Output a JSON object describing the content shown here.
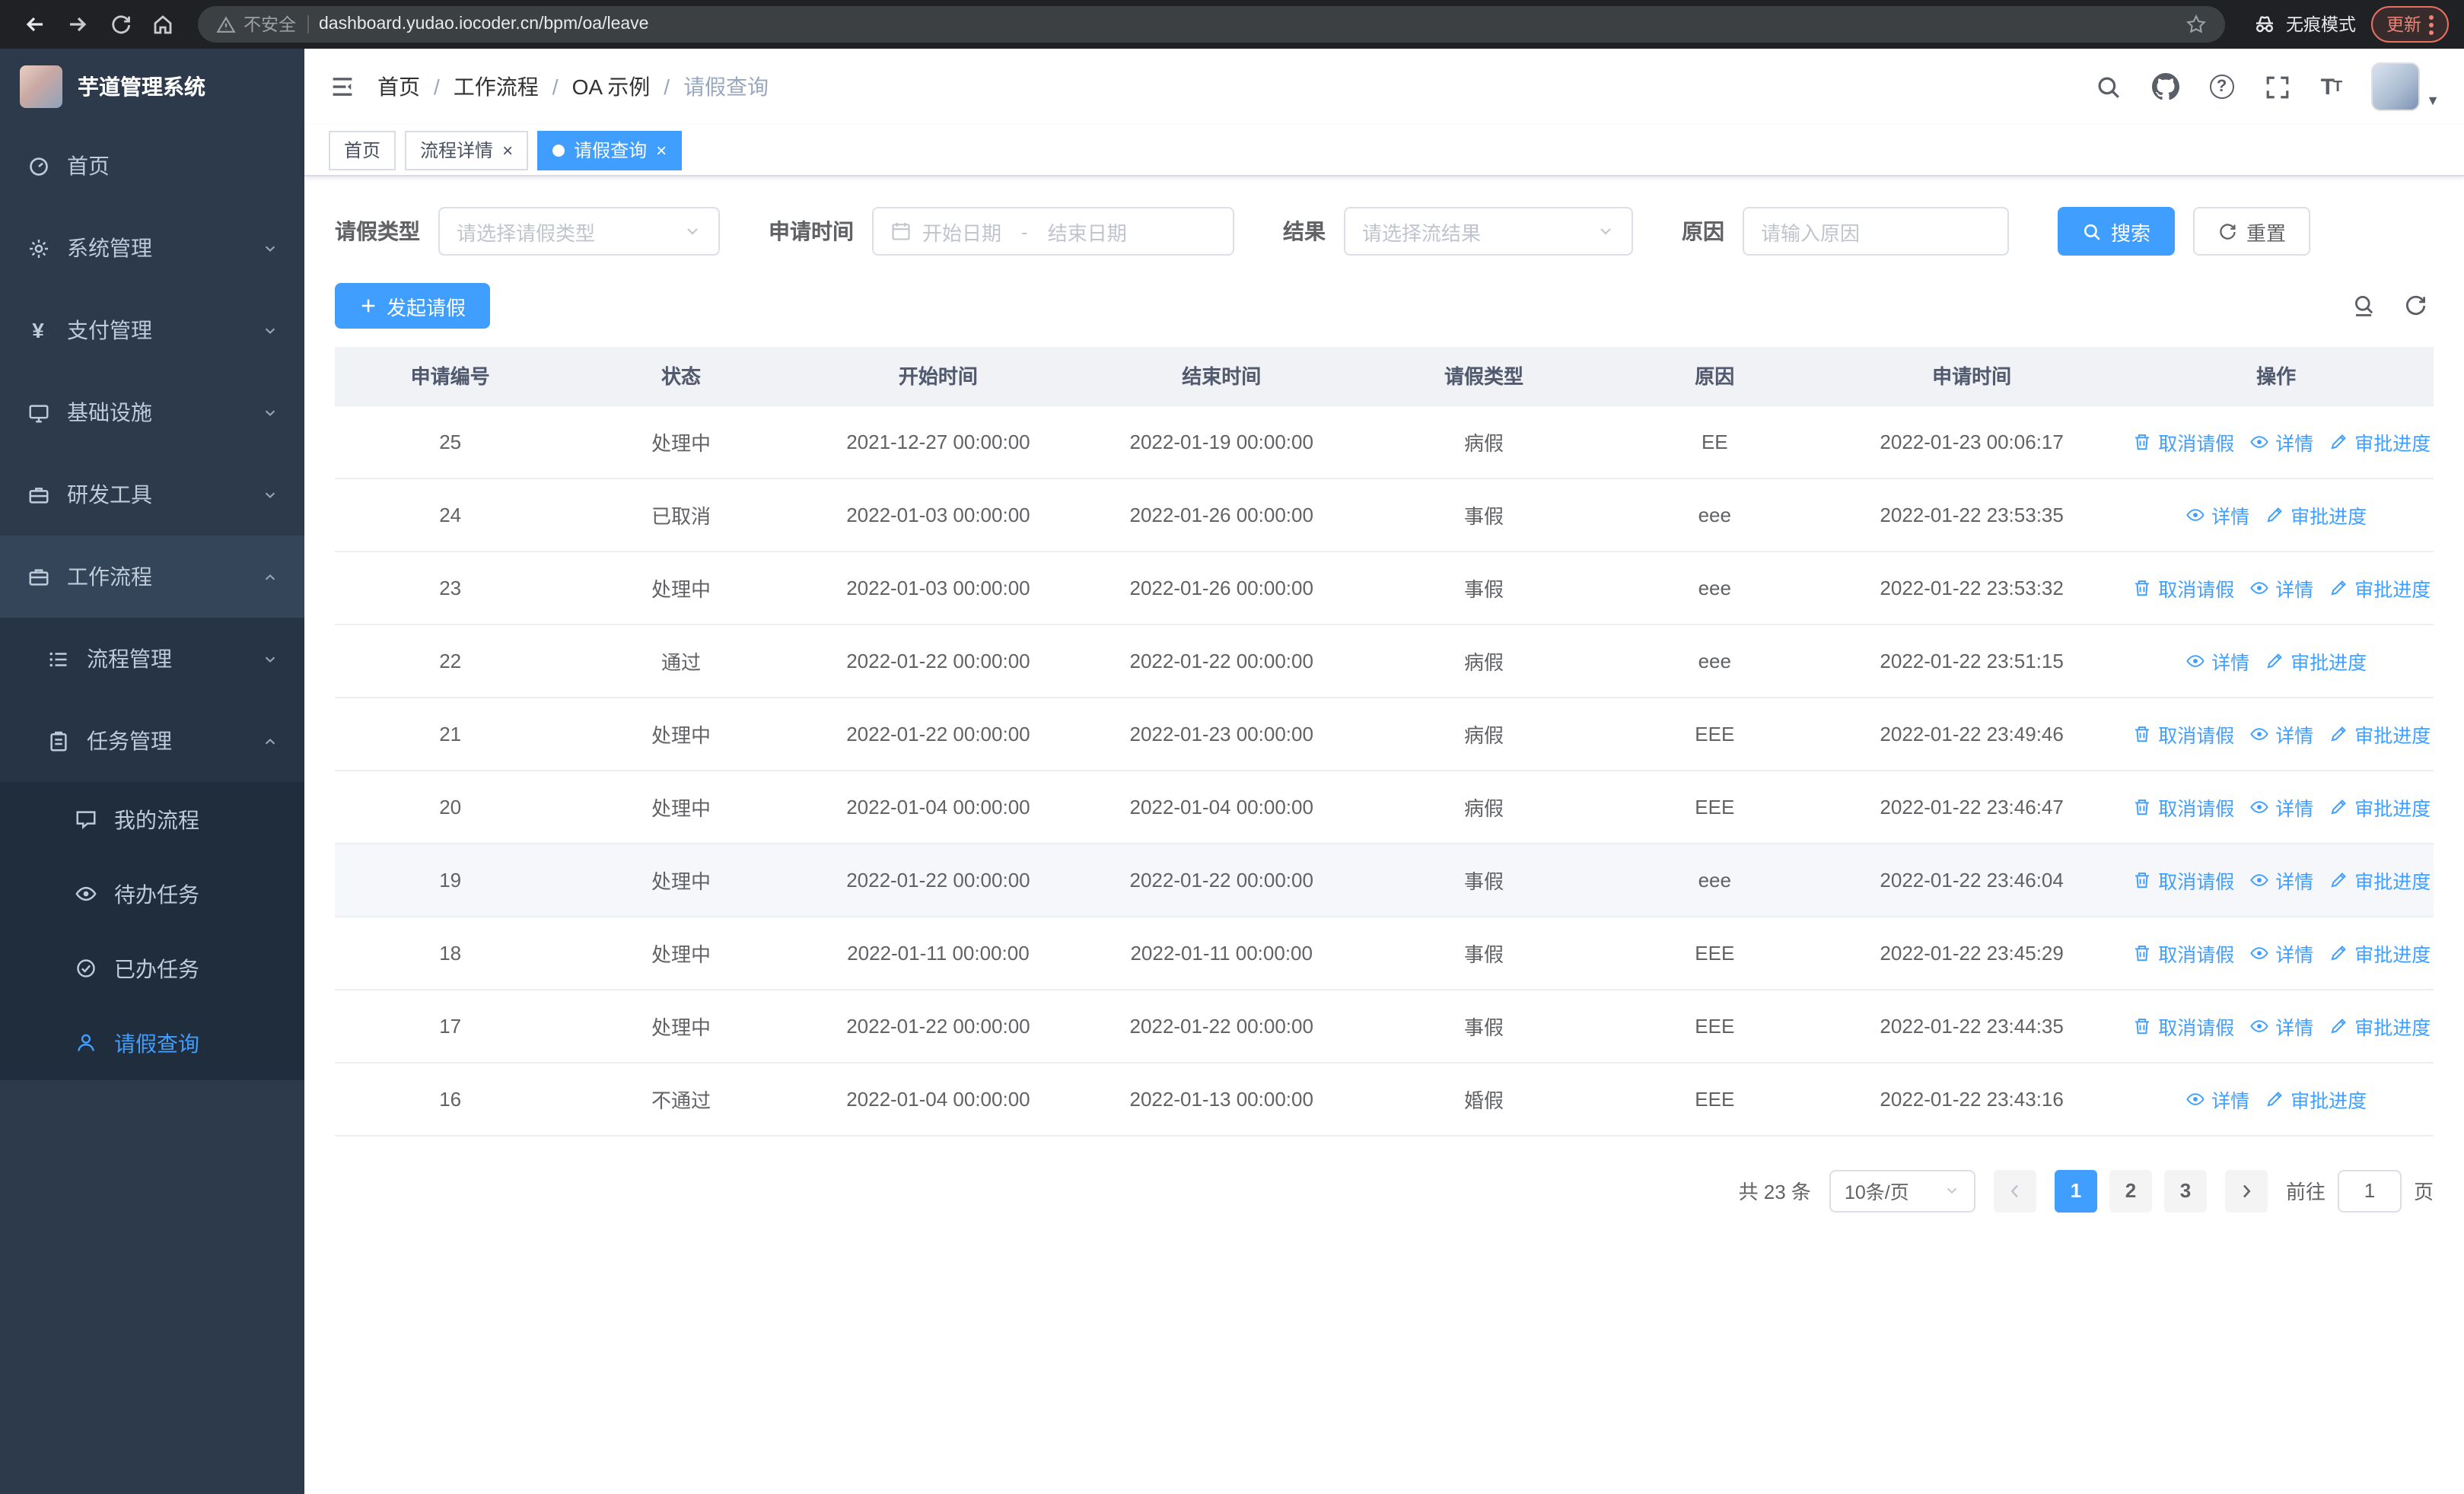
{
  "browser": {
    "security_label": "不安全",
    "url": "dashboard.yudao.iocoder.cn/bpm/oa/leave",
    "incognito_label": "无痕模式",
    "update_label": "更新"
  },
  "sidebar": {
    "title": "芋道管理系统",
    "items": [
      {
        "label": "首页"
      },
      {
        "label": "系统管理"
      },
      {
        "label": "支付管理"
      },
      {
        "label": "基础设施"
      },
      {
        "label": "研发工具"
      },
      {
        "label": "工作流程"
      },
      {
        "label": "流程管理"
      },
      {
        "label": "任务管理"
      },
      {
        "label": "我的流程"
      },
      {
        "label": "待办任务"
      },
      {
        "label": "已办任务"
      },
      {
        "label": "请假查询"
      }
    ]
  },
  "breadcrumb": {
    "separator": "/",
    "items": [
      "首页",
      "工作流程",
      "OA 示例",
      "请假查询"
    ]
  },
  "tabs": {
    "items": [
      {
        "label": "首页"
      },
      {
        "label": "流程详情"
      },
      {
        "label": "请假查询"
      }
    ]
  },
  "filters": {
    "leave_type_label": "请假类型",
    "leave_type_placeholder": "请选择请假类型",
    "apply_time_label": "申请时间",
    "start_date_placeholder": "开始日期",
    "range_separator": "-",
    "end_date_placeholder": "结束日期",
    "result_label": "结果",
    "result_placeholder": "请选择流结果",
    "reason_label": "原因",
    "reason_placeholder": "请输入原因",
    "search_button": "搜索",
    "reset_button": "重置"
  },
  "toolbar": {
    "create_button": "发起请假"
  },
  "table": {
    "headers": [
      "申请编号",
      "状态",
      "开始时间",
      "结束时间",
      "请假类型",
      "原因",
      "申请时间",
      "操作"
    ],
    "actions": {
      "cancel": "取消请假",
      "detail": "详情",
      "progress": "审批进度"
    },
    "rows": [
      {
        "id": "25",
        "status": "处理中",
        "start": "2021-12-27 00:00:00",
        "end": "2022-01-19 00:00:00",
        "type": "病假",
        "reason": "EE",
        "applied": "2022-01-23 00:06:17",
        "cancelable": true,
        "highlight": false
      },
      {
        "id": "24",
        "status": "已取消",
        "start": "2022-01-03 00:00:00",
        "end": "2022-01-26 00:00:00",
        "type": "事假",
        "reason": "eee",
        "applied": "2022-01-22 23:53:35",
        "cancelable": false,
        "highlight": false
      },
      {
        "id": "23",
        "status": "处理中",
        "start": "2022-01-03 00:00:00",
        "end": "2022-01-26 00:00:00",
        "type": "事假",
        "reason": "eee",
        "applied": "2022-01-22 23:53:32",
        "cancelable": true,
        "highlight": false
      },
      {
        "id": "22",
        "status": "通过",
        "start": "2022-01-22 00:00:00",
        "end": "2022-01-22 00:00:00",
        "type": "病假",
        "reason": "eee",
        "applied": "2022-01-22 23:51:15",
        "cancelable": false,
        "highlight": false
      },
      {
        "id": "21",
        "status": "处理中",
        "start": "2022-01-22 00:00:00",
        "end": "2022-01-23 00:00:00",
        "type": "病假",
        "reason": "EEE",
        "applied": "2022-01-22 23:49:46",
        "cancelable": true,
        "highlight": false
      },
      {
        "id": "20",
        "status": "处理中",
        "start": "2022-01-04 00:00:00",
        "end": "2022-01-04 00:00:00",
        "type": "病假",
        "reason": "EEE",
        "applied": "2022-01-22 23:46:47",
        "cancelable": true,
        "highlight": false
      },
      {
        "id": "19",
        "status": "处理中",
        "start": "2022-01-22 00:00:00",
        "end": "2022-01-22 00:00:00",
        "type": "事假",
        "reason": "eee",
        "applied": "2022-01-22 23:46:04",
        "cancelable": true,
        "highlight": true
      },
      {
        "id": "18",
        "status": "处理中",
        "start": "2022-01-11 00:00:00",
        "end": "2022-01-11 00:00:00",
        "type": "事假",
        "reason": "EEE",
        "applied": "2022-01-22 23:45:29",
        "cancelable": true,
        "highlight": false
      },
      {
        "id": "17",
        "status": "处理中",
        "start": "2022-01-22 00:00:00",
        "end": "2022-01-22 00:00:00",
        "type": "事假",
        "reason": "EEE",
        "applied": "2022-01-22 23:44:35",
        "cancelable": true,
        "highlight": false
      },
      {
        "id": "16",
        "status": "不通过",
        "start": "2022-01-04 00:00:00",
        "end": "2022-01-13 00:00:00",
        "type": "婚假",
        "reason": "EEE",
        "applied": "2022-01-22 23:43:16",
        "cancelable": false,
        "highlight": false
      }
    ]
  },
  "pagination": {
    "total_label": "共 23 条",
    "page_size": "10条/页",
    "pages": [
      "1",
      "2",
      "3"
    ],
    "active_page": "1",
    "goto_label": "前往",
    "goto_value": "1",
    "page_unit": "页"
  },
  "colors": {
    "primary": "#409eff",
    "sidebar_bg": "#2d3a4b",
    "submenu_bg": "#263445",
    "leaf_bg": "#1f2d3d",
    "browser_bg": "#202124",
    "update_accent": "#e8705f"
  },
  "icons": [
    "back-icon",
    "forward-icon",
    "reload-icon",
    "home-icon",
    "warning-icon",
    "star-icon",
    "incognito-icon",
    "more-dots-icon",
    "hamburger-icon",
    "search-icon",
    "github-icon",
    "help-icon",
    "fullscreen-icon",
    "font-size-icon",
    "chevron-down-icon",
    "calendar-icon",
    "plus-icon",
    "refresh-icon",
    "trash-icon",
    "eye-icon",
    "edit-icon",
    "dashboard-icon",
    "gear-icon",
    "yen-icon",
    "monitor-icon",
    "toolbox-icon",
    "briefcase-icon",
    "list-icon",
    "clipboard-icon",
    "chat-icon",
    "check-circle-icon",
    "person-icon",
    "close-icon",
    "arrow-left-icon",
    "arrow-right-icon"
  ]
}
